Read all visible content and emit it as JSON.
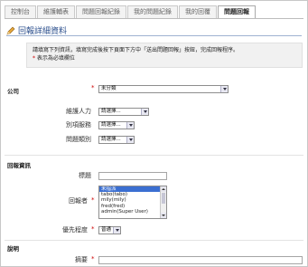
{
  "tabs": [
    {
      "label": "控制台"
    },
    {
      "label": "維護輔表"
    },
    {
      "label": "問題回報紀錄"
    },
    {
      "label": "我的問題紀錄"
    },
    {
      "label": "我的回覆"
    },
    {
      "label": "問題回報"
    }
  ],
  "active_tab_index": 5,
  "section": {
    "title": "回報詳細資料"
  },
  "notice": {
    "line1": "請填寫下列資訊，填寫完成後按下頁面下方中「送出問題回報」按鈕，完成回報程序。",
    "required_note": "表示為必填欄位",
    "required_star": "*"
  },
  "form": {
    "company": {
      "label": "公司",
      "value": "未分類"
    },
    "maintenance": {
      "label": "維護人力",
      "value": "請選擇..."
    },
    "project": {
      "label": "別項服務",
      "value": "請選擇..."
    },
    "category": {
      "label": "問題類別",
      "value": "請選擇..."
    },
    "report_section": "回報資訊",
    "title_field": {
      "label": "標題"
    },
    "reporter": {
      "label": "回報者",
      "options": [
        "未指派",
        "tabo(tabo)",
        "mily(mily)",
        "fred(fred)",
        "admin(Super User)"
      ]
    },
    "priority": {
      "label": "優先程度",
      "value": "普通"
    },
    "desc_section": "說明",
    "summary": {
      "label": "摘要"
    }
  },
  "colors": {
    "accent": "#2a4e8c",
    "required": "#cc0000",
    "selected": "#3b6fd1"
  }
}
